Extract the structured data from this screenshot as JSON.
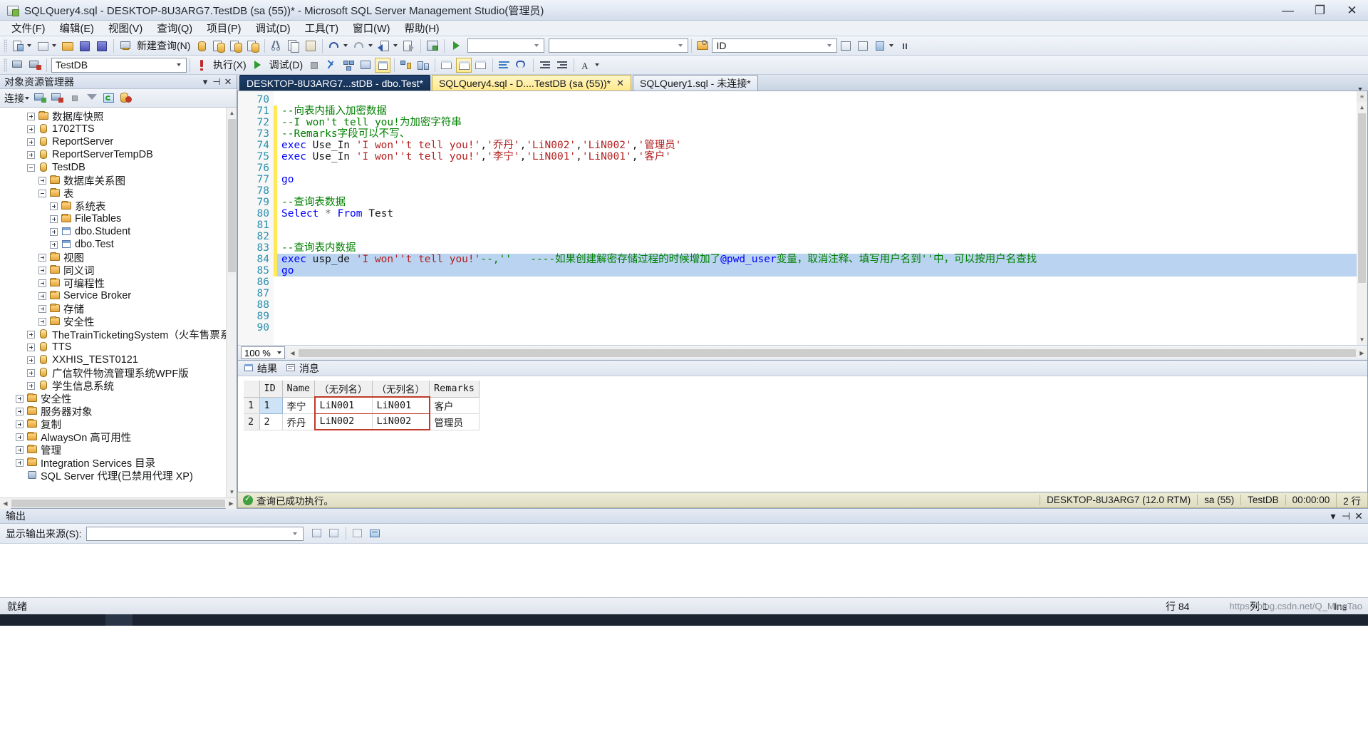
{
  "window": {
    "title": "SQLQuery4.sql - DESKTOP-8U3ARG7.TestDB (sa (55))* - Microsoft SQL Server Management Studio(管理员)",
    "minimize": "—",
    "maximize": "❐",
    "close": "✕"
  },
  "menu": [
    "文件(F)",
    "编辑(E)",
    "视图(V)",
    "查询(Q)",
    "项目(P)",
    "调试(D)",
    "工具(T)",
    "窗口(W)",
    "帮助(H)"
  ],
  "toolbar1": {
    "new_query_label": "新建查询(N)",
    "combo1": "",
    "combo2": "",
    "find_value": "ID"
  },
  "toolbar2": {
    "database": "TestDB",
    "execute_label": "执行(X)",
    "debug_label": "调试(D)"
  },
  "object_explorer": {
    "title": "对象资源管理器",
    "connect_label": "连接",
    "nodes": [
      {
        "label": "数据库快照",
        "icon": "folder-icon",
        "indent": 2,
        "state": "plus"
      },
      {
        "label": "1702TTS",
        "icon": "database-icon",
        "indent": 2,
        "state": "plus"
      },
      {
        "label": "ReportServer",
        "icon": "database-icon",
        "indent": 2,
        "state": "plus"
      },
      {
        "label": "ReportServerTempDB",
        "icon": "database-icon",
        "indent": 2,
        "state": "plus"
      },
      {
        "label": "TestDB",
        "icon": "database-icon",
        "indent": 2,
        "state": "minus"
      },
      {
        "label": "数据库关系图",
        "icon": "folder-icon",
        "indent": 3,
        "state": "plus"
      },
      {
        "label": "表",
        "icon": "folder-icon",
        "indent": 3,
        "state": "minus"
      },
      {
        "label": "系统表",
        "icon": "folder-icon",
        "indent": 4,
        "state": "plus"
      },
      {
        "label": "FileTables",
        "icon": "folder-icon",
        "indent": 4,
        "state": "plus"
      },
      {
        "label": "dbo.Student",
        "icon": "table-icon",
        "indent": 4,
        "state": "plus"
      },
      {
        "label": "dbo.Test",
        "icon": "table-icon",
        "indent": 4,
        "state": "plus"
      },
      {
        "label": "视图",
        "icon": "folder-icon",
        "indent": 3,
        "state": "plus"
      },
      {
        "label": "同义词",
        "icon": "folder-icon",
        "indent": 3,
        "state": "plus"
      },
      {
        "label": "可编程性",
        "icon": "folder-icon",
        "indent": 3,
        "state": "plus"
      },
      {
        "label": "Service Broker",
        "icon": "folder-icon",
        "indent": 3,
        "state": "plus"
      },
      {
        "label": "存储",
        "icon": "folder-icon",
        "indent": 3,
        "state": "plus"
      },
      {
        "label": "安全性",
        "icon": "folder-icon",
        "indent": 3,
        "state": "plus"
      },
      {
        "label": "TheTrainTicketingSystem（火车售票系统）",
        "icon": "database-icon",
        "indent": 2,
        "state": "plus"
      },
      {
        "label": "TTS",
        "icon": "database-icon",
        "indent": 2,
        "state": "plus"
      },
      {
        "label": "XXHIS_TEST0121",
        "icon": "database-icon",
        "indent": 2,
        "state": "plus"
      },
      {
        "label": "广信软件物流管理系统WPF版",
        "icon": "database-icon",
        "indent": 2,
        "state": "plus"
      },
      {
        "label": "学生信息系统",
        "icon": "database-icon",
        "indent": 2,
        "state": "plus"
      },
      {
        "label": "安全性",
        "icon": "folder-icon",
        "indent": 1,
        "state": "plus"
      },
      {
        "label": "服务器对象",
        "icon": "folder-icon",
        "indent": 1,
        "state": "plus"
      },
      {
        "label": "复制",
        "icon": "folder-icon",
        "indent": 1,
        "state": "plus"
      },
      {
        "label": "AlwaysOn 高可用性",
        "icon": "folder-icon",
        "indent": 1,
        "state": "plus"
      },
      {
        "label": "管理",
        "icon": "folder-icon",
        "indent": 1,
        "state": "plus"
      },
      {
        "label": "Integration Services 目录",
        "icon": "folder-icon",
        "indent": 1,
        "state": "plus"
      },
      {
        "label": "SQL Server 代理(已禁用代理 XP)",
        "icon": "agent-icon",
        "indent": 1,
        "state": "none"
      }
    ]
  },
  "tabs": [
    {
      "label": "DESKTOP-8U3ARG7...stDB - dbo.Test*",
      "state": "inactive",
      "close": ""
    },
    {
      "label": "SQLQuery4.sql - D....TestDB (sa (55))*",
      "state": "active",
      "close": "✕"
    },
    {
      "label": "SQLQuery1.sql - 未连接*",
      "state": "other",
      "close": ""
    }
  ],
  "editor": {
    "first_line": 70,
    "lines": [
      {
        "n": 70,
        "segs": []
      },
      {
        "n": 71,
        "segs": [
          {
            "t": "--向表内插入加密数据",
            "c": "cmt"
          }
        ]
      },
      {
        "n": 72,
        "segs": [
          {
            "t": "--I won't tell you!为加密字符串",
            "c": "cmt"
          }
        ]
      },
      {
        "n": 73,
        "segs": [
          {
            "t": "--Remarks字段可以不写、",
            "c": "cmt"
          }
        ]
      },
      {
        "n": 74,
        "segs": [
          {
            "t": "exec",
            "c": "kw"
          },
          {
            "t": " Use_In ",
            "c": "plain"
          },
          {
            "t": "'I won''t tell you!'",
            "c": "str"
          },
          {
            "t": ",",
            "c": "plain"
          },
          {
            "t": "'乔丹'",
            "c": "str"
          },
          {
            "t": ",",
            "c": "plain"
          },
          {
            "t": "'LiN002'",
            "c": "str"
          },
          {
            "t": ",",
            "c": "plain"
          },
          {
            "t": "'LiN002'",
            "c": "str"
          },
          {
            "t": ",",
            "c": "plain"
          },
          {
            "t": "'管理员'",
            "c": "str"
          }
        ]
      },
      {
        "n": 75,
        "segs": [
          {
            "t": "exec",
            "c": "kw"
          },
          {
            "t": " Use_In ",
            "c": "plain"
          },
          {
            "t": "'I won''t tell you!'",
            "c": "str"
          },
          {
            "t": ",",
            "c": "plain"
          },
          {
            "t": "'李宁'",
            "c": "str"
          },
          {
            "t": ",",
            "c": "plain"
          },
          {
            "t": "'LiN001'",
            "c": "str"
          },
          {
            "t": ",",
            "c": "plain"
          },
          {
            "t": "'LiN001'",
            "c": "str"
          },
          {
            "t": ",",
            "c": "plain"
          },
          {
            "t": "'客户'",
            "c": "str"
          }
        ]
      },
      {
        "n": 76,
        "segs": []
      },
      {
        "n": 77,
        "segs": [
          {
            "t": "go",
            "c": "kw"
          }
        ]
      },
      {
        "n": 78,
        "segs": []
      },
      {
        "n": 79,
        "segs": [
          {
            "t": "--查询表数据",
            "c": "cmt"
          }
        ]
      },
      {
        "n": 80,
        "segs": [
          {
            "t": "Select",
            "c": "kw"
          },
          {
            "t": " * ",
            "c": "op"
          },
          {
            "t": "From",
            "c": "kw"
          },
          {
            "t": " Test",
            "c": "plain"
          }
        ]
      },
      {
        "n": 81,
        "segs": []
      },
      {
        "n": 82,
        "segs": []
      },
      {
        "n": 83,
        "segs": [
          {
            "t": "--查询表内数据",
            "c": "cmt"
          }
        ]
      },
      {
        "n": 84,
        "selected": true,
        "segs": [
          {
            "t": "exec",
            "c": "kw"
          },
          {
            "t": " usp_de ",
            "c": "plain"
          },
          {
            "t": "'I won''t tell you!'",
            "c": "str"
          },
          {
            "t": "--,''",
            "c": "cmt"
          },
          {
            "t": "   ----如果创建解密存储过程的时候增加了",
            "c": "cmt"
          },
          {
            "t": "@pwd_user",
            "c": "var"
          },
          {
            "t": "变量，取消注释、填写用户名到''中，可以按用户名查找",
            "c": "cmt"
          }
        ]
      },
      {
        "n": 85,
        "selected": true,
        "segs": [
          {
            "t": "go",
            "c": "kw"
          }
        ]
      },
      {
        "n": 86,
        "segs": []
      },
      {
        "n": 87,
        "segs": []
      },
      {
        "n": 88,
        "segs": []
      },
      {
        "n": 89,
        "segs": []
      },
      {
        "n": 90,
        "segs": []
      }
    ],
    "zoom": "100 %"
  },
  "results": {
    "tabs": [
      {
        "label": "结果",
        "icon": "grid-icon"
      },
      {
        "label": "消息",
        "icon": "message-icon"
      }
    ],
    "columns": [
      "ID",
      "Name",
      "（无列名）",
      "（无列名）",
      "Remarks"
    ],
    "rows": [
      {
        "num": "1",
        "cells": [
          "1",
          "李宁",
          "LiN001",
          "LiN001",
          "客户"
        ]
      },
      {
        "num": "2",
        "cells": [
          "2",
          "乔丹",
          "LiN002",
          "LiN002",
          "管理员"
        ]
      }
    ]
  },
  "query_status": {
    "message": "查询已成功执行。",
    "server": "DESKTOP-8U3ARG7 (12.0 RTM)",
    "user": "sa (55)",
    "database": "TestDB",
    "elapsed": "00:00:00",
    "rows": "2 行"
  },
  "output_panel": {
    "title": "输出",
    "source_label": "显示输出来源(S):",
    "source_value": ""
  },
  "statusbar": {
    "state": "就绪",
    "line_label": "行 84",
    "col_label": "列 1",
    "ins_label": "Ins",
    "watermark": "https://blog.csdn.net/Q_MingTao"
  },
  "colors": {
    "accent": "#2b91af",
    "keyword": "#0000ff",
    "comment": "#008000",
    "string": "#b41f1f",
    "selection": "#b9d3f0",
    "red_border": "#c0392b"
  }
}
